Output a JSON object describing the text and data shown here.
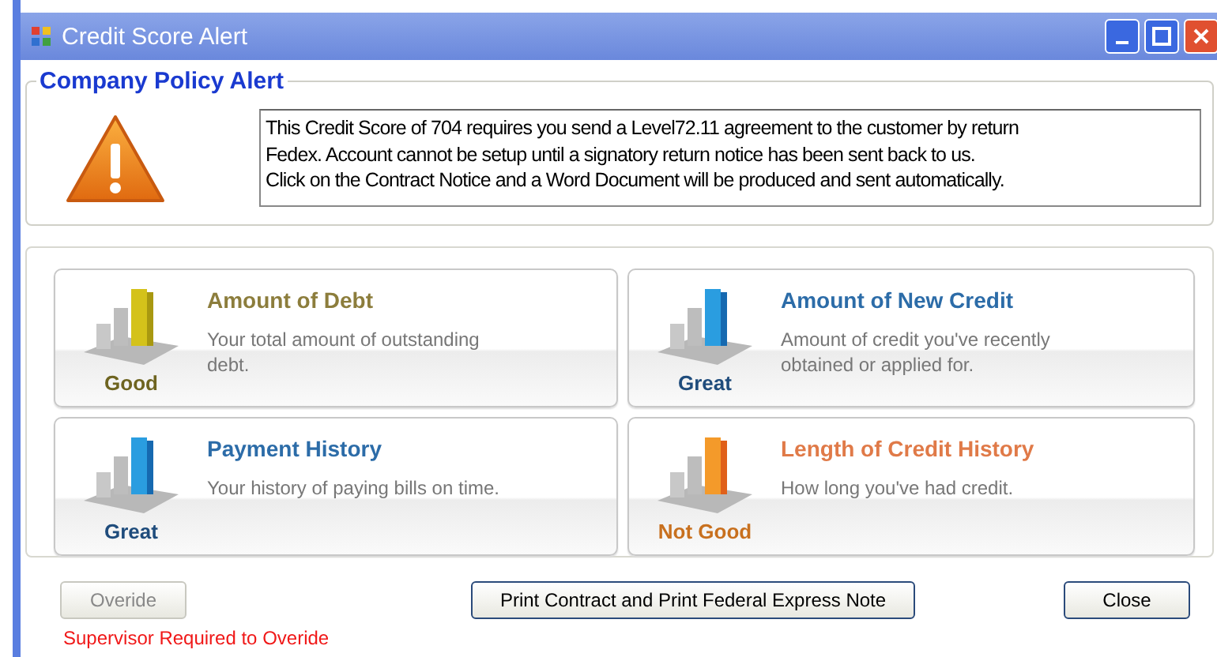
{
  "window": {
    "title": "Credit Score Alert"
  },
  "policy": {
    "legend": "Company Policy Alert",
    "message": "This Credit Score of 704 requires you send a Level72.11 agreement to the customer by return\nFedex. Account cannot be setup until a signatory return notice has been sent back to us.\nClick on the Contract Notice and a Word Document will be produced and sent automatically."
  },
  "factors": [
    {
      "title": "Amount of Debt",
      "description": "Your total amount of outstanding debt.",
      "rating": "Good",
      "kind": "good"
    },
    {
      "title": "Amount of New Credit",
      "description": "Amount of credit you've recently obtained or applied for.",
      "rating": "Great",
      "kind": "great"
    },
    {
      "title": "Payment History",
      "description": "Your history of paying bills on time.",
      "rating": "Great",
      "kind": "great"
    },
    {
      "title": "Length of Credit History",
      "description": "How long you've had credit.",
      "rating": "Not Good",
      "kind": "not_good"
    }
  ],
  "buttons": {
    "override": {
      "label": "Overide",
      "disabled": true
    },
    "print": {
      "label": "Print Contract and Print Federal Express Note"
    },
    "close": {
      "label": "Close"
    }
  },
  "warning": "Supervisor Required to Overide"
}
